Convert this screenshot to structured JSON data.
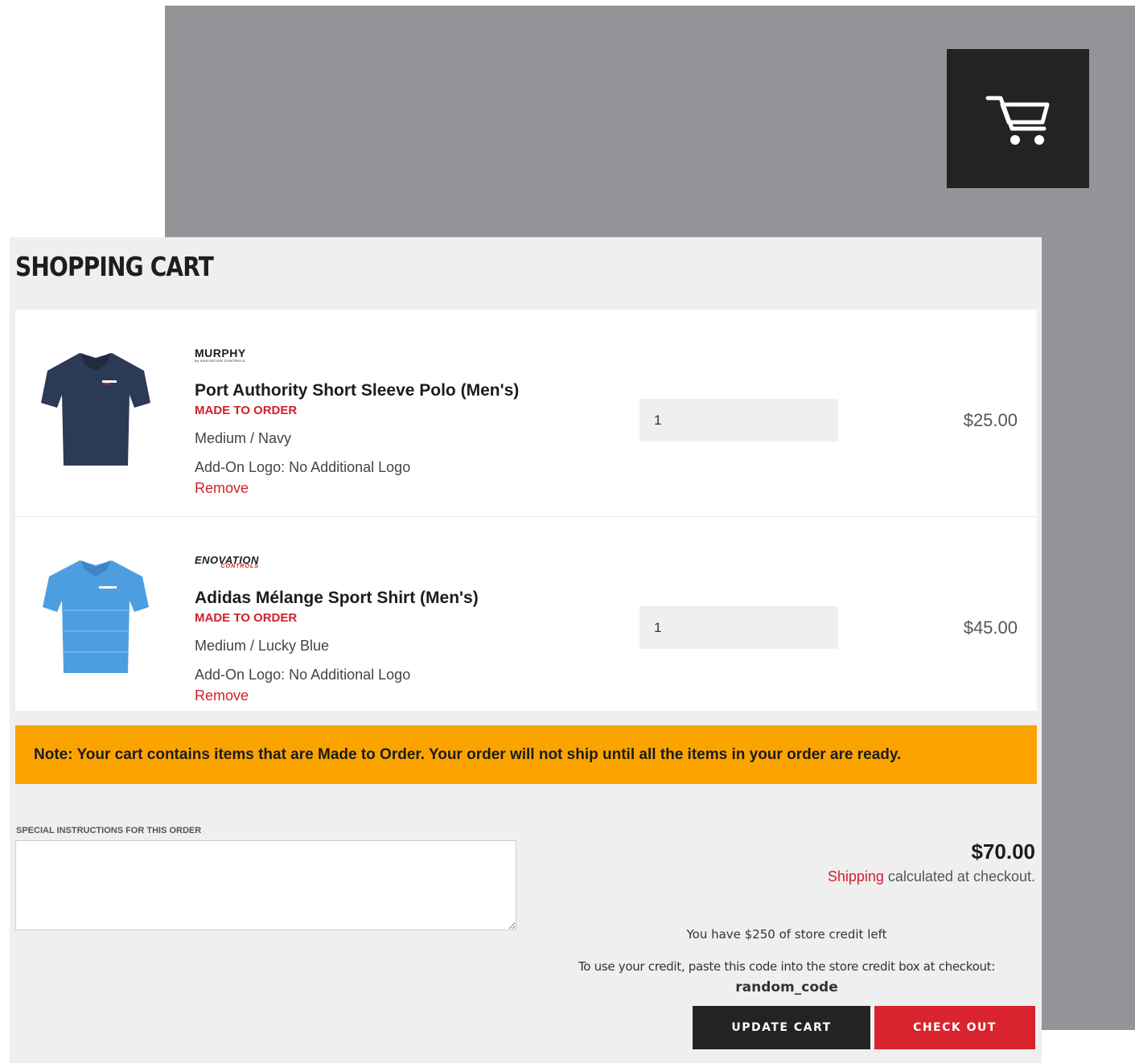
{
  "header": {
    "cart_icon": "shopping-cart-icon"
  },
  "page": {
    "title": "SHOPPING CART"
  },
  "items": [
    {
      "brand": "MURPHY",
      "brand_sub": "by ENOVATION CONTROLS",
      "title": "Port Authority Short Sleeve Polo (Men's)",
      "badge": "MADE TO ORDER",
      "variant": "Medium / Navy",
      "addon": "Add-On Logo: No Additional Logo",
      "remove_label": "Remove",
      "quantity": "1",
      "price": "$25.00",
      "shirt_color": "#2b3a55"
    },
    {
      "brand": "ENOVATION",
      "brand_sub": "CONTROLS",
      "title": "Adidas Mélange Sport Shirt (Men's)",
      "badge": "MADE TO ORDER",
      "variant": "Medium / Lucky Blue",
      "addon": "Add-On Logo: No Additional Logo",
      "remove_label": "Remove",
      "quantity": "1",
      "price": "$45.00",
      "shirt_color": "#4d9ee0"
    }
  ],
  "note": "Note: Your cart contains items that are Made to Order. Your order will not ship until all the items in your order are ready.",
  "instructions": {
    "label": "SPECIAL INSTRUCTIONS FOR THIS ORDER",
    "value": ""
  },
  "summary": {
    "subtotal": "$70.00",
    "shipping_link": "Shipping",
    "shipping_text": " calculated at checkout."
  },
  "credit": {
    "left_text": "You have $250 of store credit left",
    "hint_text": "To use your credit, paste this code into the store credit box at checkout:",
    "code": "random_code"
  },
  "buttons": {
    "update": "UPDATE CART",
    "checkout": "CHECK OUT"
  },
  "colors": {
    "accent_red": "#d1212b",
    "note_orange": "#fba400",
    "dark": "#232323",
    "backdrop_grey": "#939497"
  }
}
